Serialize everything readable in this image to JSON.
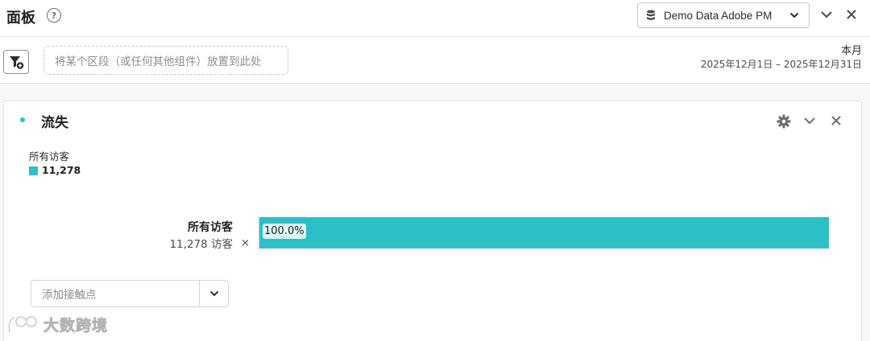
{
  "header": {
    "title": "面板",
    "help_icon": "help-icon",
    "report_suite": "Demo Data Adobe PM"
  },
  "dropzone": {
    "placeholder": "将某个区段（或任何其他组件）放置到此处"
  },
  "date_range": {
    "label": "本月",
    "dates": "2025年12月1日 – 2025年12月31日"
  },
  "card": {
    "title": "流失",
    "legend": {
      "name": "所有访客",
      "value": "11,278"
    },
    "row": {
      "label": "所有访客",
      "count": "11,278 访客",
      "remove": "×",
      "percent_label": "100.0%",
      "fill_percent": 100
    },
    "touchpoint_placeholder": "添加接触点"
  },
  "watermark": {
    "text": "大数跨境"
  },
  "colors": {
    "accent": "#2cbfc6"
  }
}
